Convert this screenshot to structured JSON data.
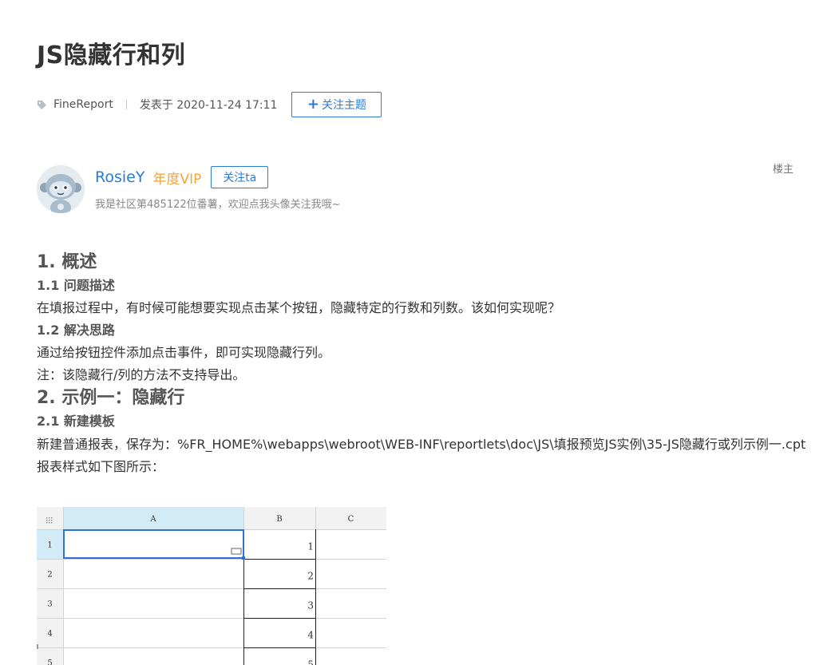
{
  "post": {
    "title": "JS隐藏行和列",
    "category": "FineReport",
    "posted": "发表于 2020-11-24 17:11",
    "follow_topic_label": "关注主题"
  },
  "author": {
    "name": "RosieY",
    "badge": "年度VIP",
    "follow_label": "关注ta",
    "signature": "我是社区第485122位番薯，欢迎点我头像关注我哦~",
    "role": "楼主"
  },
  "icons": {
    "tag": "tag-icon",
    "plus": "plus-icon",
    "avatar": "robot-avatar"
  },
  "colors": {
    "accent": "#2b7bd6",
    "vip": "#f0a43a",
    "sheet_header_selected": "#d2ebf7",
    "sheet_selection": "#2f6fde"
  },
  "article": {
    "s1_title": "1. 概述",
    "s1_1_title": "1.1 问题描述",
    "s1_1_text": "在填报过程中，有时候可能想要实现点击某个按钮，隐藏特定的行数和列数。该如何实现呢？",
    "s1_2_title": "1.2 解决思路",
    "s1_2_text": "通过给按钮控件添加点击事件，即可实现隐藏行列。",
    "s1_2_note": "注：该隐藏行/列的方法不支持导出。",
    "s2_title": "2. 示例一：隐藏行",
    "s2_1_title": "2.1 新建模板",
    "s2_1_text": "新建普通报表，保存为：%FR_HOME%\\webapps\\webroot\\WEB-INF\\reportlets\\doc\\JS\\填报预览JS实例\\35-JS隐藏行或列示例一.cpt",
    "s2_1_caption": "报表样式如下图所示："
  },
  "sheet": {
    "columns": [
      "A",
      "B",
      "C"
    ],
    "rows": [
      "1",
      "2",
      "3",
      "4",
      "5"
    ],
    "b_values": [
      "1",
      "2",
      "3",
      "4",
      "5"
    ]
  }
}
